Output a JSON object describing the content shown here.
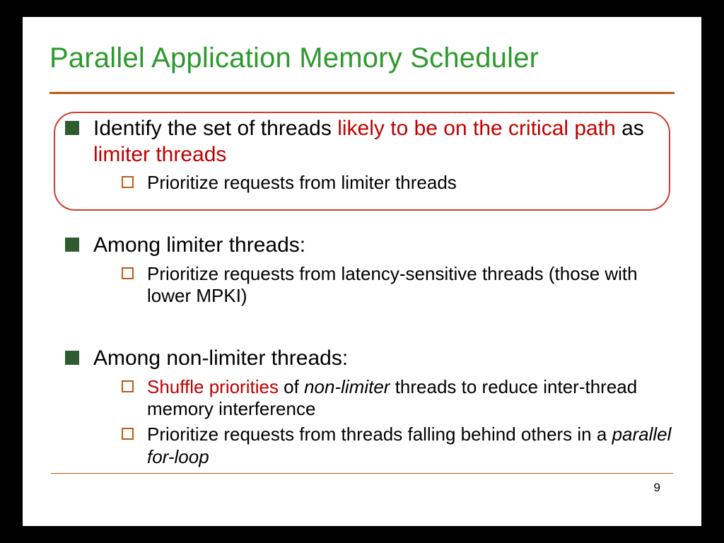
{
  "title": "Parallel Application Memory Scheduler",
  "items": [
    {
      "text_parts": [
        {
          "t": "Identify the set of threads "
        },
        {
          "t": "likely to be on the critical path",
          "cls": "red-text"
        },
        {
          "t": " as "
        },
        {
          "t": "limiter threads",
          "cls": "red-text"
        }
      ],
      "subs": [
        {
          "text_parts": [
            {
              "t": "Prioritize requests from limiter threads"
            }
          ]
        }
      ]
    },
    {
      "text_parts": [
        {
          "t": "Among limiter threads:"
        }
      ],
      "subs": [
        {
          "text_parts": [
            {
              "t": "Prioritize requests from latency-sensitive threads (those with lower MPKI)"
            }
          ]
        }
      ]
    },
    {
      "text_parts": [
        {
          "t": "Among non-limiter threads:"
        }
      ],
      "subs": [
        {
          "text_parts": [
            {
              "t": "Shuffle priorities",
              "cls": "red-text"
            },
            {
              "t": " of "
            },
            {
              "t": "non-limiter",
              "cls": "em"
            },
            {
              "t": " threads to reduce inter-thread memory interference"
            }
          ]
        },
        {
          "text_parts": [
            {
              "t": "Prioritize requests from threads falling behind others in a "
            },
            {
              "t": "parallel for-loop",
              "cls": "em"
            }
          ]
        }
      ]
    }
  ],
  "page_number": "9"
}
